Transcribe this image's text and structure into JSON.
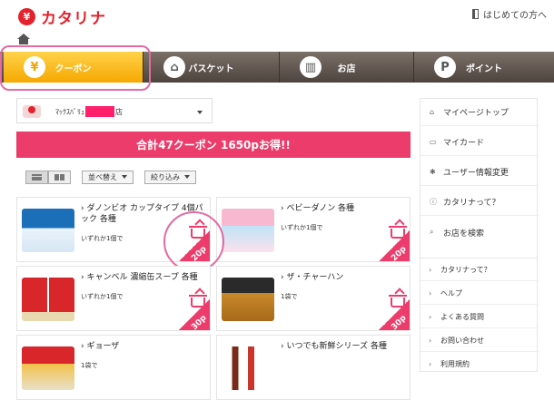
{
  "header": {
    "logo_mark": "¥",
    "logo_text": "カタリナ",
    "first_time_link": "はじめての方へ"
  },
  "nav": [
    {
      "label": "クーポン",
      "icon": "yen-coin-icon",
      "glyph": "¥"
    },
    {
      "label": "バスケット",
      "icon": "basket-icon",
      "glyph": "⌂"
    },
    {
      "label": "お店",
      "icon": "store-icon",
      "glyph": "▥"
    },
    {
      "label": "ポイント",
      "icon": "point-icon",
      "glyph": "P"
    }
  ],
  "store_select": {
    "prefix": "ﾏｯｸｽﾊﾞﾘｭ",
    "suffix": "店"
  },
  "banner_text": "合計47クーポン 1650pお得!!",
  "toolbar": {
    "sort_label": "並べ替え",
    "filter_label": "絞り込み"
  },
  "coupons": [
    {
      "title": "ダノンビオ カップタイプ 4個パック 各種",
      "condition": "いずれか1個で",
      "points": "20p"
    },
    {
      "title": "ベビーダノン 各種",
      "condition": "いずれか1個で",
      "points": "20p"
    },
    {
      "title": "キャンベル 濃縮缶スープ 各種",
      "condition": "いずれか1個で",
      "points": "30p"
    },
    {
      "title": "ザ・チャーハン",
      "condition": "1袋で",
      "points": "30p"
    },
    {
      "title": "ギョーザ",
      "condition": "1袋で",
      "points": ""
    },
    {
      "title": "いつでも新鮮シリーズ 各種",
      "condition": "",
      "points": ""
    }
  ],
  "sidebar_top": [
    {
      "label": "マイページトップ",
      "icon": "home-icon",
      "glyph": "⌂"
    },
    {
      "label": "マイカード",
      "icon": "card-icon",
      "glyph": "▭"
    },
    {
      "label": "ユーザー情報変更",
      "icon": "gear-icon",
      "glyph": "✱"
    },
    {
      "label": "カタリナって？",
      "icon": "info-icon",
      "glyph": "ⓘ"
    },
    {
      "label": "お店を検索",
      "icon": "search-icon",
      "glyph": "⌕"
    }
  ],
  "sidebar_bottom": [
    {
      "label": "カタリナって？",
      "glyph": "›"
    },
    {
      "label": "ヘルプ",
      "glyph": "›"
    },
    {
      "label": "よくある質問",
      "glyph": "›"
    },
    {
      "label": "お問い合わせ",
      "glyph": "›"
    },
    {
      "label": "利用規約",
      "glyph": "›"
    }
  ],
  "colors": {
    "brand_red": "#e2222c",
    "accent_pink": "#ec3c6b",
    "active_tab": "#f6a800",
    "nav_bg": "#5e544d"
  }
}
